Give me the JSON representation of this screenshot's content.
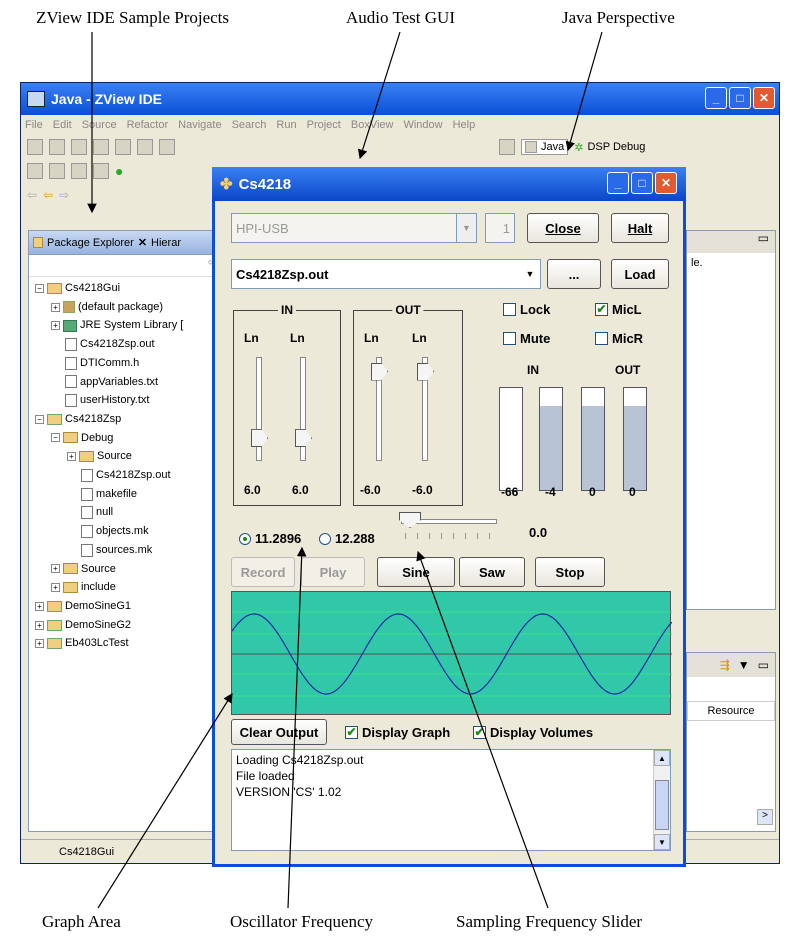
{
  "callouts": {
    "sample_projects": "ZView IDE Sample Projects",
    "audio_test_gui": "Audio Test GUI",
    "java_perspective": "Java Perspective",
    "graph_area": "Graph Area",
    "oscillator_frequency": "Oscillator Frequency",
    "sampling_frequency_slider": "Sampling Frequency Slider"
  },
  "ide": {
    "title": "Java - ZView IDE",
    "menus": [
      "File",
      "Edit",
      "Source",
      "Refactor",
      "Navigate",
      "Search",
      "Run",
      "Project",
      "BoxView",
      "Window",
      "Help"
    ],
    "perspectives": {
      "java": "Java",
      "dsp": "DSP Debug"
    },
    "package_tab": "Package Explorer",
    "hier_tab": "Hierar",
    "right_text": "le.",
    "resource_col": "Resource",
    "status": "Cs4218Gui"
  },
  "tree": [
    {
      "label": "Cs4218Gui",
      "indent": 0,
      "exp": "−",
      "icon": "pj"
    },
    {
      "label": "(default package)",
      "indent": 1,
      "exp": "+",
      "icon": "pk"
    },
    {
      "label": "JRE System Library [",
      "indent": 1,
      "exp": "+",
      "icon": "lb"
    },
    {
      "label": "Cs4218Zsp.out",
      "indent": 1,
      "exp": "",
      "icon": "fi"
    },
    {
      "label": "DTIComm.h",
      "indent": 1,
      "exp": "",
      "icon": "fi"
    },
    {
      "label": "appVariables.txt",
      "indent": 1,
      "exp": "",
      "icon": "fi"
    },
    {
      "label": "userHistory.txt",
      "indent": 1,
      "exp": "",
      "icon": "fi"
    },
    {
      "label": "Cs4218Zsp",
      "indent": 0,
      "exp": "−",
      "icon": "pj"
    },
    {
      "label": "Debug",
      "indent": 1,
      "exp": "−",
      "icon": "fo"
    },
    {
      "label": "Source",
      "indent": 2,
      "exp": "+",
      "icon": "fo"
    },
    {
      "label": "Cs4218Zsp.out",
      "indent": 2,
      "exp": "",
      "icon": "fi"
    },
    {
      "label": "makefile",
      "indent": 2,
      "exp": "",
      "icon": "fi"
    },
    {
      "label": "null",
      "indent": 2,
      "exp": "",
      "icon": "fi"
    },
    {
      "label": "objects.mk",
      "indent": 2,
      "exp": "",
      "icon": "fi"
    },
    {
      "label": "sources.mk",
      "indent": 2,
      "exp": "",
      "icon": "fi"
    },
    {
      "label": "Source",
      "indent": 1,
      "exp": "+",
      "icon": "fo"
    },
    {
      "label": "include",
      "indent": 1,
      "exp": "+",
      "icon": "fo"
    },
    {
      "label": "DemoSineG1",
      "indent": 0,
      "exp": "+",
      "icon": "pj"
    },
    {
      "label": "DemoSineG2",
      "indent": 0,
      "exp": "+",
      "icon": "pj"
    },
    {
      "label": "Eb403LcTest",
      "indent": 0,
      "exp": "+",
      "icon": "pj"
    }
  ],
  "dialog": {
    "title": "Cs4218",
    "interface": "HPI-USB",
    "board_num": "1",
    "close": "Close",
    "halt": "Halt",
    "file": "Cs4218Zsp.out",
    "browse": "...",
    "load": "Load",
    "in_group": "IN",
    "out_group": "OUT",
    "ln": "Ln",
    "in_vals": [
      "6.0",
      "6.0"
    ],
    "out_vals": [
      "-6.0",
      "-6.0"
    ],
    "in_levels": [
      0.22,
      0.22
    ],
    "out_levels": [
      0.86,
      0.86
    ],
    "lock": "Lock",
    "mute": "Mute",
    "micl": "MicL",
    "micr": "MicR",
    "meter_in": "IN",
    "meter_out": "OUT",
    "meter_vals": [
      "-66",
      "-4",
      "0",
      "0"
    ],
    "meter_levels": [
      0.0,
      0.82,
      0.82,
      0.82
    ],
    "freq1": "11.2896",
    "freq2": "12.288",
    "slider_val": "0.0",
    "record": "Record",
    "play": "Play",
    "sine": "Sine",
    "saw": "Saw",
    "stop": "Stop",
    "clear": "Clear Output",
    "display_graph": "Display Graph",
    "display_volumes": "Display Volumes",
    "output_lines": [
      "Loading Cs4218Zsp.out",
      "File loaded",
      "VERSION 'CS' 1.02"
    ]
  }
}
